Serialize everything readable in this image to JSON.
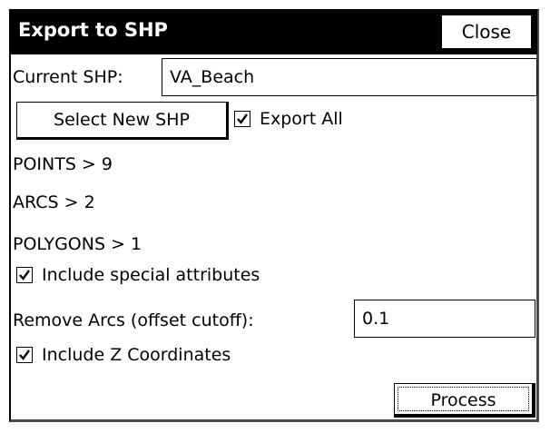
{
  "window": {
    "title": "Export to SHP",
    "close_label": "Close"
  },
  "current_shp": {
    "label": "Current SHP:",
    "value": "VA_Beach"
  },
  "select_button": {
    "label": "Select New SHP"
  },
  "export_all": {
    "label": "Export All",
    "checked": true
  },
  "counts": {
    "points": "POINTS > 9",
    "arcs": "ARCS > 2",
    "polygons": "POLYGONS > 1"
  },
  "include_special": {
    "label": "Include special attributes",
    "checked": true
  },
  "remove_arcs": {
    "label": "Remove Arcs (offset cutoff):",
    "value": "0.1"
  },
  "include_z": {
    "label": "Include Z Coordinates",
    "checked": true
  },
  "process_button": {
    "label": "Process"
  }
}
